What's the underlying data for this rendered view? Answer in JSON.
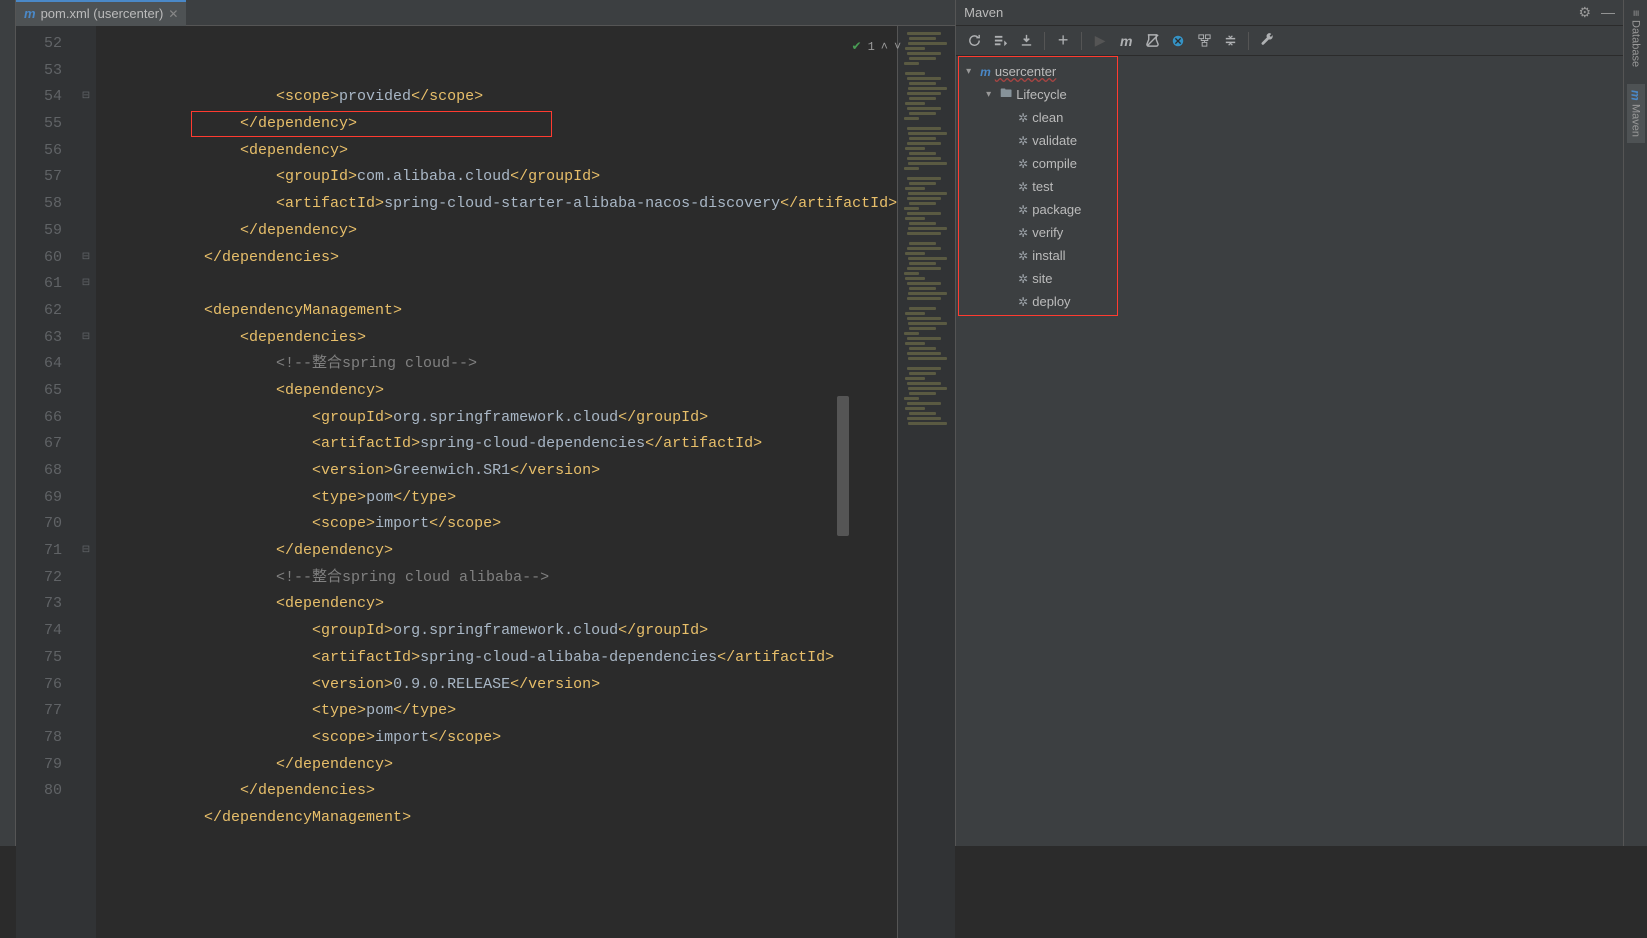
{
  "tab": {
    "title": "pom.xml (usercenter)"
  },
  "annotations": {
    "count": "1"
  },
  "lines": [
    {
      "n": "52",
      "html": "                    <span class='t-tag'>&lt;scope&gt;</span><span class='t-text'>provided</span><span class='t-tag'>&lt;/scope&gt;</span>"
    },
    {
      "n": "53",
      "html": "                <span class='t-tag'>&lt;/dependency&gt;</span>"
    },
    {
      "n": "54",
      "html": "                <span class='t-tag'>&lt;dependency&gt;</span>"
    },
    {
      "n": "55",
      "html": "                    <span class='t-tag'>&lt;groupId&gt;</span><span class='t-text'>com.alibaba.cloud</span><span class='t-tag'>&lt;/groupId&gt;</span>"
    },
    {
      "n": "56",
      "html": "                    <span class='t-tag'>&lt;artifactId&gt;</span><span class='t-text'>spring-cloud-starter-alibaba-nacos-discovery</span><span class='t-tag'>&lt;/artifactId&gt;</span>"
    },
    {
      "n": "57",
      "html": "                <span class='t-tag'>&lt;/dependency&gt;</span>"
    },
    {
      "n": "58",
      "html": "            <span class='t-tag'>&lt;/dependencies&gt;</span>"
    },
    {
      "n": "59",
      "html": ""
    },
    {
      "n": "60",
      "html": "            <span class='t-tag'>&lt;dependencyManagement&gt;</span>"
    },
    {
      "n": "61",
      "html": "                <span class='t-tag'>&lt;dependencies&gt;</span>"
    },
    {
      "n": "62",
      "html": "                    <span class='t-comment'>&lt;!--整合spring cloud--&gt;</span>"
    },
    {
      "n": "63",
      "html": "                    <span class='t-tag'>&lt;dependency&gt;</span>"
    },
    {
      "n": "64",
      "html": "                        <span class='t-tag'>&lt;groupId&gt;</span><span class='t-text'>org.springframework.cloud</span><span class='t-tag'>&lt;/groupId&gt;</span>"
    },
    {
      "n": "65",
      "html": "                        <span class='t-tag'>&lt;artifactId&gt;</span><span class='t-text'>spring-cloud-dependencies</span><span class='t-tag'>&lt;/artifactId&gt;</span>"
    },
    {
      "n": "66",
      "html": "                        <span class='t-tag'>&lt;version&gt;</span><span class='t-text'>Greenwich.SR1</span><span class='t-tag'>&lt;/version&gt;</span>"
    },
    {
      "n": "67",
      "html": "                        <span class='t-tag'>&lt;type&gt;</span><span class='t-text'>pom</span><span class='t-tag'>&lt;/type&gt;</span>"
    },
    {
      "n": "68",
      "html": "                        <span class='t-tag'>&lt;scope&gt;</span><span class='t-text'>import</span><span class='t-tag'>&lt;/scope&gt;</span>"
    },
    {
      "n": "69",
      "html": "                    <span class='t-tag'>&lt;/dependency&gt;</span>"
    },
    {
      "n": "70",
      "html": "                    <span class='t-comment'>&lt;!--整合spring cloud alibaba--&gt;</span>"
    },
    {
      "n": "71",
      "html": "                    <span class='t-tag'>&lt;dependency&gt;</span>"
    },
    {
      "n": "72",
      "html": "                        <span class='t-tag'>&lt;groupId&gt;</span><span class='t-text'>org.springframework.cloud</span><span class='t-tag'>&lt;/groupId&gt;</span>"
    },
    {
      "n": "73",
      "html": "                        <span class='t-tag'>&lt;artifactId&gt;</span><span class='t-text'>spring-cloud-alibaba-dependencies</span><span class='t-tag'>&lt;/artifactId&gt;</span>"
    },
    {
      "n": "74",
      "html": "                        <span class='t-tag'>&lt;version&gt;</span><span class='t-text'>0.9.0.RELEASE</span><span class='t-tag'>&lt;/version&gt;</span>"
    },
    {
      "n": "75",
      "html": "                        <span class='t-tag'>&lt;type&gt;</span><span class='t-text'>pom</span><span class='t-tag'>&lt;/type&gt;</span>"
    },
    {
      "n": "76",
      "html": "                        <span class='t-tag'>&lt;scope&gt;</span><span class='t-text'>import</span><span class='t-tag'>&lt;/scope&gt;</span>"
    },
    {
      "n": "77",
      "html": "                    <span class='t-tag'>&lt;/dependency&gt;</span>"
    },
    {
      "n": "78",
      "html": "                <span class='t-tag'>&lt;/dependencies&gt;</span>"
    },
    {
      "n": "79",
      "html": "            <span class='t-tag'>&lt;/dependencyManagement&gt;</span>"
    },
    {
      "n": "80",
      "html": ""
    }
  ],
  "maven": {
    "title": "Maven",
    "project": "usercenter",
    "lifecycle_label": "Lifecycle",
    "phases": [
      "clean",
      "validate",
      "compile",
      "test",
      "package",
      "verify",
      "install",
      "site",
      "deploy"
    ]
  },
  "right_tabs": {
    "database": "Database",
    "maven": "Maven"
  }
}
